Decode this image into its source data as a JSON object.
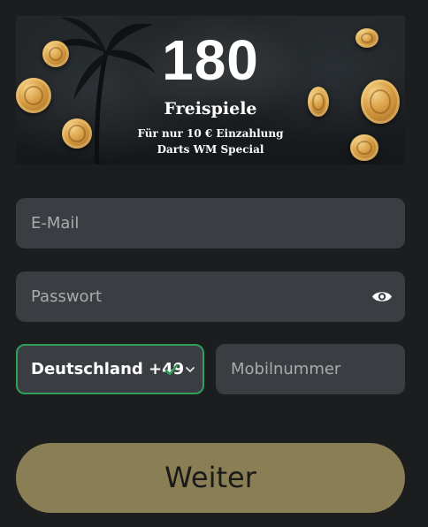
{
  "banner": {
    "number": "180",
    "title": "Freispiele",
    "line1": "Für nur 10 € Einzahlung",
    "line2": "Darts WM Special"
  },
  "form": {
    "email_placeholder": "E-Mail",
    "password_placeholder": "Passwort",
    "country_value": "Deutschland +49",
    "mobile_placeholder": "Mobilnummer",
    "submit_label": "Weiter"
  },
  "colors": {
    "background": "#1b1d1f",
    "field": "#3a3d41",
    "valid_border": "#2fa05a",
    "button": "#8a7e55"
  },
  "icons": {
    "password_toggle": "eye-icon",
    "country_valid": "checkmark-icon",
    "country_dropdown": "chevron-down-icon"
  }
}
